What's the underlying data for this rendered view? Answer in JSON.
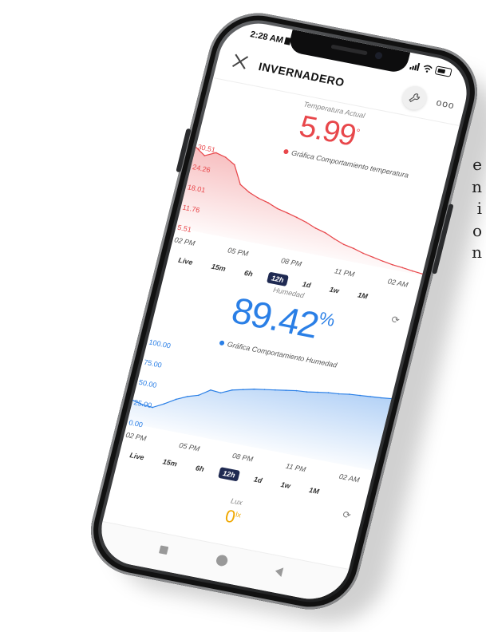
{
  "side_text": [
    "e",
    "n",
    "i",
    "o",
    "n"
  ],
  "status_bar": {
    "time": "2:28 AM"
  },
  "header": {
    "title": "INVERNADERO",
    "more_label": "ooo"
  },
  "temperature": {
    "label": "Temperatura Actual",
    "value": "5.99",
    "unit": "°",
    "legend": "Gráfica Comportamiento temperatura",
    "color": "#e8474b"
  },
  "humidity": {
    "label": "Humedad",
    "value": "89.42",
    "unit": "%",
    "legend": "Gráfica Comportamiento Humedad",
    "color": "#2a7fe6"
  },
  "lux": {
    "label": "Lux",
    "value": "0",
    "unit": "lx"
  },
  "chart_data": [
    {
      "type": "area",
      "title": "Gráfica Comportamiento temperatura",
      "y_ticks": [
        "30.51",
        "24.26",
        "18.01",
        "11.76",
        "5.51"
      ],
      "x_ticks": [
        "02 PM",
        "05 PM",
        "08 PM",
        "11 PM",
        "02 AM"
      ],
      "ylim": [
        5.51,
        30.51
      ],
      "x": [
        0,
        0.5,
        1,
        1.5,
        2,
        2.5,
        3,
        3.5,
        4,
        4.5,
        5,
        5.5,
        6,
        6.5,
        7,
        7.5,
        8,
        8.5,
        9,
        9.5,
        10,
        10.5,
        11,
        11.5,
        12
      ],
      "values": [
        30.5,
        28.5,
        30.0,
        29.2,
        27.5,
        22.0,
        20.2,
        19.0,
        18.2,
        17.0,
        16.3,
        15.5,
        14.6,
        13.4,
        12.6,
        11.3,
        10.2,
        9.6,
        8.7,
        8.1,
        7.5,
        7.0,
        6.7,
        6.3,
        5.99
      ],
      "color": "#e8474b",
      "range_buttons": [
        "Live",
        "15m",
        "6h",
        "12h",
        "1d",
        "1w",
        "1M"
      ],
      "active_range": "12h"
    },
    {
      "type": "area",
      "title": "Gráfica Comportamiento Humedad",
      "y_ticks": [
        "100.00",
        "75.00",
        "50.00",
        "25.00",
        "0.00"
      ],
      "x_ticks": [
        "02 PM",
        "05 PM",
        "08 PM",
        "11 PM",
        "02 AM"
      ],
      "ylim": [
        0,
        100
      ],
      "x": [
        0,
        0.5,
        1,
        1.5,
        2,
        2.5,
        3,
        3.5,
        4,
        4.5,
        5,
        5.5,
        6,
        6.5,
        7,
        7.5,
        8,
        8.5,
        9,
        9.5,
        10,
        10.5,
        11,
        11.5,
        12
      ],
      "values": [
        28,
        25,
        24,
        31,
        39,
        45,
        49,
        58,
        57,
        63,
        66,
        69,
        71,
        73,
        75,
        77,
        78,
        80,
        82,
        83,
        85,
        86,
        87,
        88,
        89.42
      ],
      "color": "#2a7fe6",
      "range_buttons": [
        "Live",
        "15m",
        "6h",
        "12h",
        "1d",
        "1w",
        "1M"
      ],
      "active_range": "12h"
    }
  ]
}
